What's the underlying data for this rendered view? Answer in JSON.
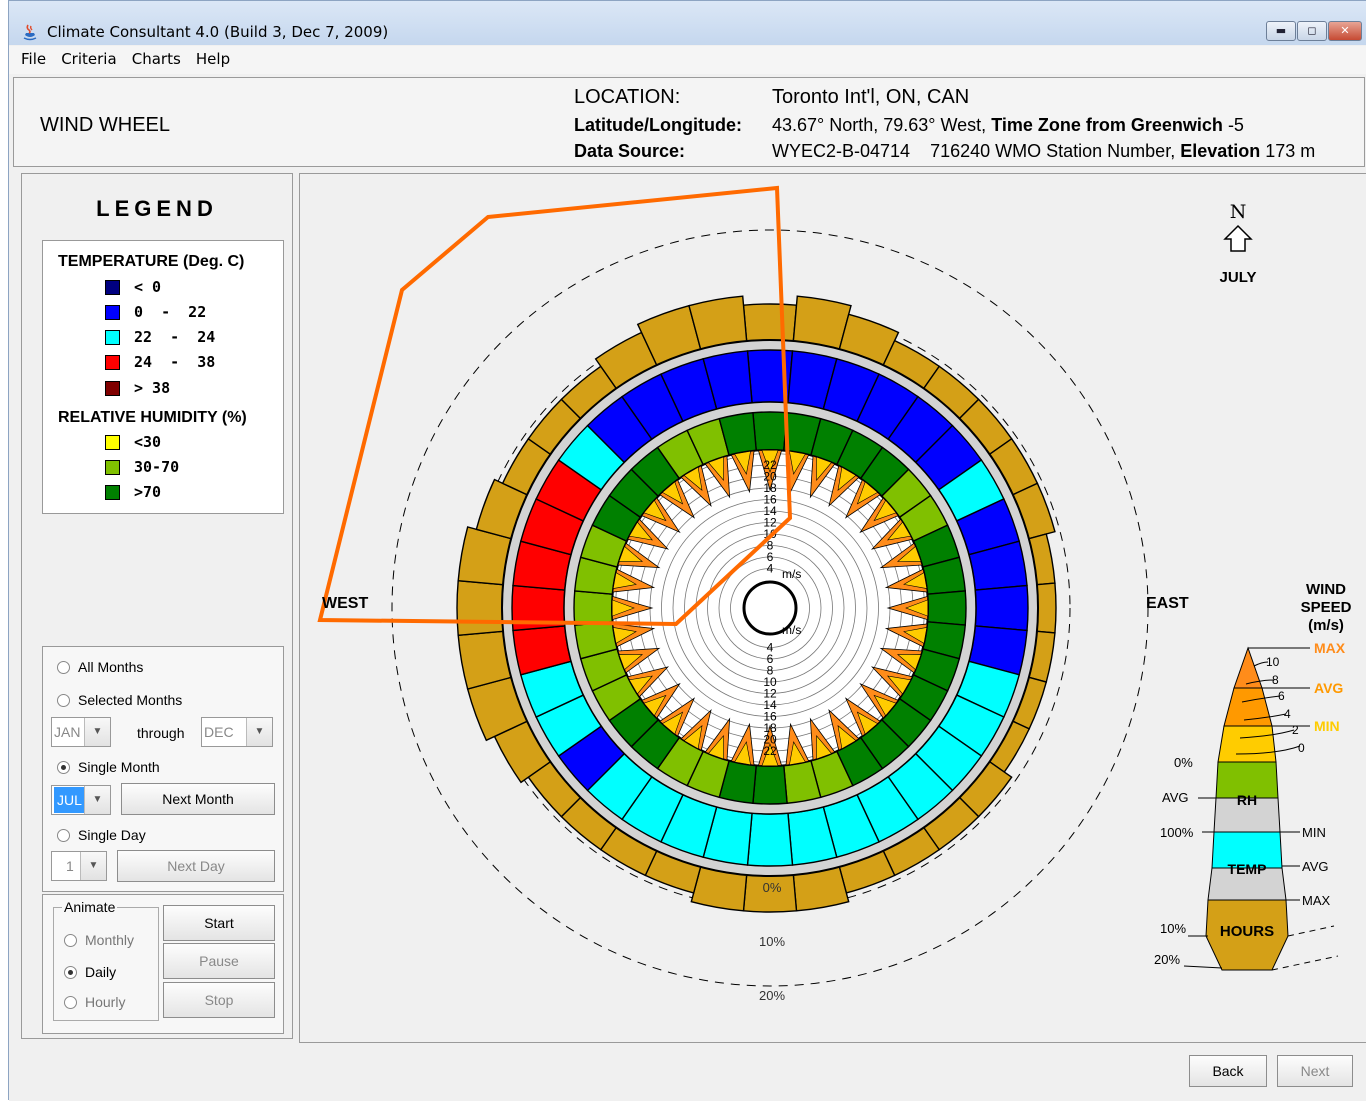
{
  "window": {
    "title": "Climate Consultant 4.0 (Build 3, Dec 7, 2009)",
    "icon": "java-coffee-icon",
    "buttons": [
      "minimize-icon",
      "maximize-icon",
      "close-icon"
    ]
  },
  "menu": [
    "File",
    "Criteria",
    "Charts",
    "Help"
  ],
  "header": {
    "panel_title": "WIND WHEEL",
    "location_label": "LOCATION:",
    "location_value": "Toronto Int'l, ON, CAN",
    "latlong_label": "Latitude/Longitude:",
    "latlong_value": "43.67° North, 79.63° West,",
    "timezone_label": "Time Zone from Greenwich",
    "timezone_value": "-5",
    "source_label": "Data Source:",
    "source_value": "WYEC2-B-04714",
    "station_value": "716240 WMO Station Number,",
    "elevation_label": "Elevation",
    "elevation_value": "173 m"
  },
  "legend": {
    "title": "LEGEND",
    "temp_heading": "TEMPERATURE (Deg. C)",
    "temp_items": [
      {
        "label": "< 0",
        "color": "#000080"
      },
      {
        "label": "0  -  22",
        "color": "#0000ff"
      },
      {
        "label": "22  -  24",
        "color": "#00ffff"
      },
      {
        "label": "24  -  38",
        "color": "#ff0000"
      },
      {
        "label": "> 38",
        "color": "#800000"
      }
    ],
    "rh_heading": "RELATIVE HUMIDITY (%)",
    "rh_items": [
      {
        "label": "<30",
        "color": "#ffff00"
      },
      {
        "label": "30-70",
        "color": "#80c000"
      },
      {
        "label": ">70",
        "color": "#008000"
      }
    ]
  },
  "controls": {
    "all_months": "All Months",
    "selected_months": "Selected Months",
    "from_month": "JAN",
    "through": "through",
    "to_month": "DEC",
    "single_month": "Single Month",
    "month_value": "JUL",
    "next_month": "Next Month",
    "single_day": "Single Day",
    "day_value": "1",
    "next_day": "Next Day",
    "selected_mode": "Single Month"
  },
  "animate": {
    "label": "Animate",
    "monthly": "Monthly",
    "daily": "Daily",
    "hourly": "Hourly",
    "start": "Start",
    "pause": "Pause",
    "stop": "Stop",
    "selected": "Daily"
  },
  "chart": {
    "compass_n": "N",
    "month": "JULY",
    "west": "WEST",
    "east": "EAST",
    "speed_unit": "m/s",
    "speed_rings": [
      "22",
      "20",
      "18",
      "16",
      "14",
      "12",
      "10",
      "8",
      "6",
      "4"
    ],
    "percent_labels": [
      "0%",
      "10%",
      "20%"
    ],
    "key": {
      "title": [
        "WIND",
        "SPEED",
        "(m/s)"
      ],
      "max": "MAX",
      "avg": "AVG",
      "min": "MIN",
      "speed_ticks": [
        "10",
        "8",
        "6",
        "4",
        "2",
        "0"
      ],
      "rh_zero": "0%",
      "rh_avg": "AVG",
      "rh_hundred": "100%",
      "rh": "RH",
      "temp": "TEMP",
      "temp_min": "MIN",
      "temp_avg": "AVG",
      "temp_max": "MAX",
      "hours": "HOURS",
      "hours_10": "10%",
      "hours_20": "20%"
    },
    "colors": {
      "wind_max": "#ff8c1a",
      "wind_avg": "#ff9900",
      "wind_min": "#ffcc00",
      "hours": "#d4a017",
      "ring_gray": "#d3d3d3",
      "annotation": "#ff6a00"
    }
  },
  "chart_data": {
    "type": "wind-wheel",
    "month": "JULY",
    "directions": 36,
    "rh_by_sector": [
      "g",
      "g",
      "g",
      "g",
      "g",
      "lg",
      "lg",
      "g",
      "g",
      "g",
      "g",
      "g",
      "g",
      "g",
      "g",
      "g",
      "lg",
      "lg",
      "g",
      "g",
      "lg",
      "lg",
      "g",
      "g",
      "lg",
      "lg",
      "lg",
      "lg",
      "lg",
      "lg",
      "g",
      "g",
      "g",
      "lg",
      "lg",
      "g"
    ],
    "temp_by_sector": [
      "b",
      "b",
      "b",
      "b",
      "b",
      "b",
      "c",
      "b",
      "b",
      "b",
      "b",
      "c",
      "c",
      "c",
      "c",
      "c",
      "c",
      "c",
      "c",
      "c",
      "c",
      "c",
      "c",
      "b",
      "c",
      "c",
      "r",
      "r",
      "r",
      "r",
      "r",
      "c",
      "b",
      "b",
      "b",
      "b"
    ],
    "hours_pct_by_sector": [
      4,
      5,
      4,
      3,
      3,
      3,
      3,
      3,
      2,
      2,
      2,
      2,
      2,
      3,
      3,
      3,
      3,
      4,
      4,
      4,
      3,
      3,
      3,
      3,
      4,
      5,
      5,
      5,
      5,
      4,
      3,
      3,
      3,
      4,
      5,
      5
    ]
  },
  "nav": {
    "back": "Back",
    "next": "Next"
  }
}
